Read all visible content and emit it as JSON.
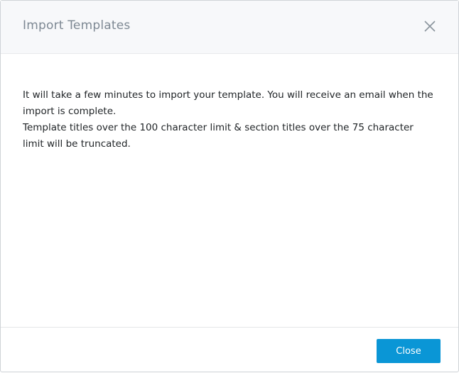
{
  "dialog": {
    "title": "Import Templates",
    "message_1": "It will take a few minutes to import your template. You will receive an email when the import is complete.",
    "message_2": "Template titles over the 100 character limit & section titles over the 75 character limit will be truncated.",
    "close_label": "Close",
    "accent": "#0a96d6"
  }
}
